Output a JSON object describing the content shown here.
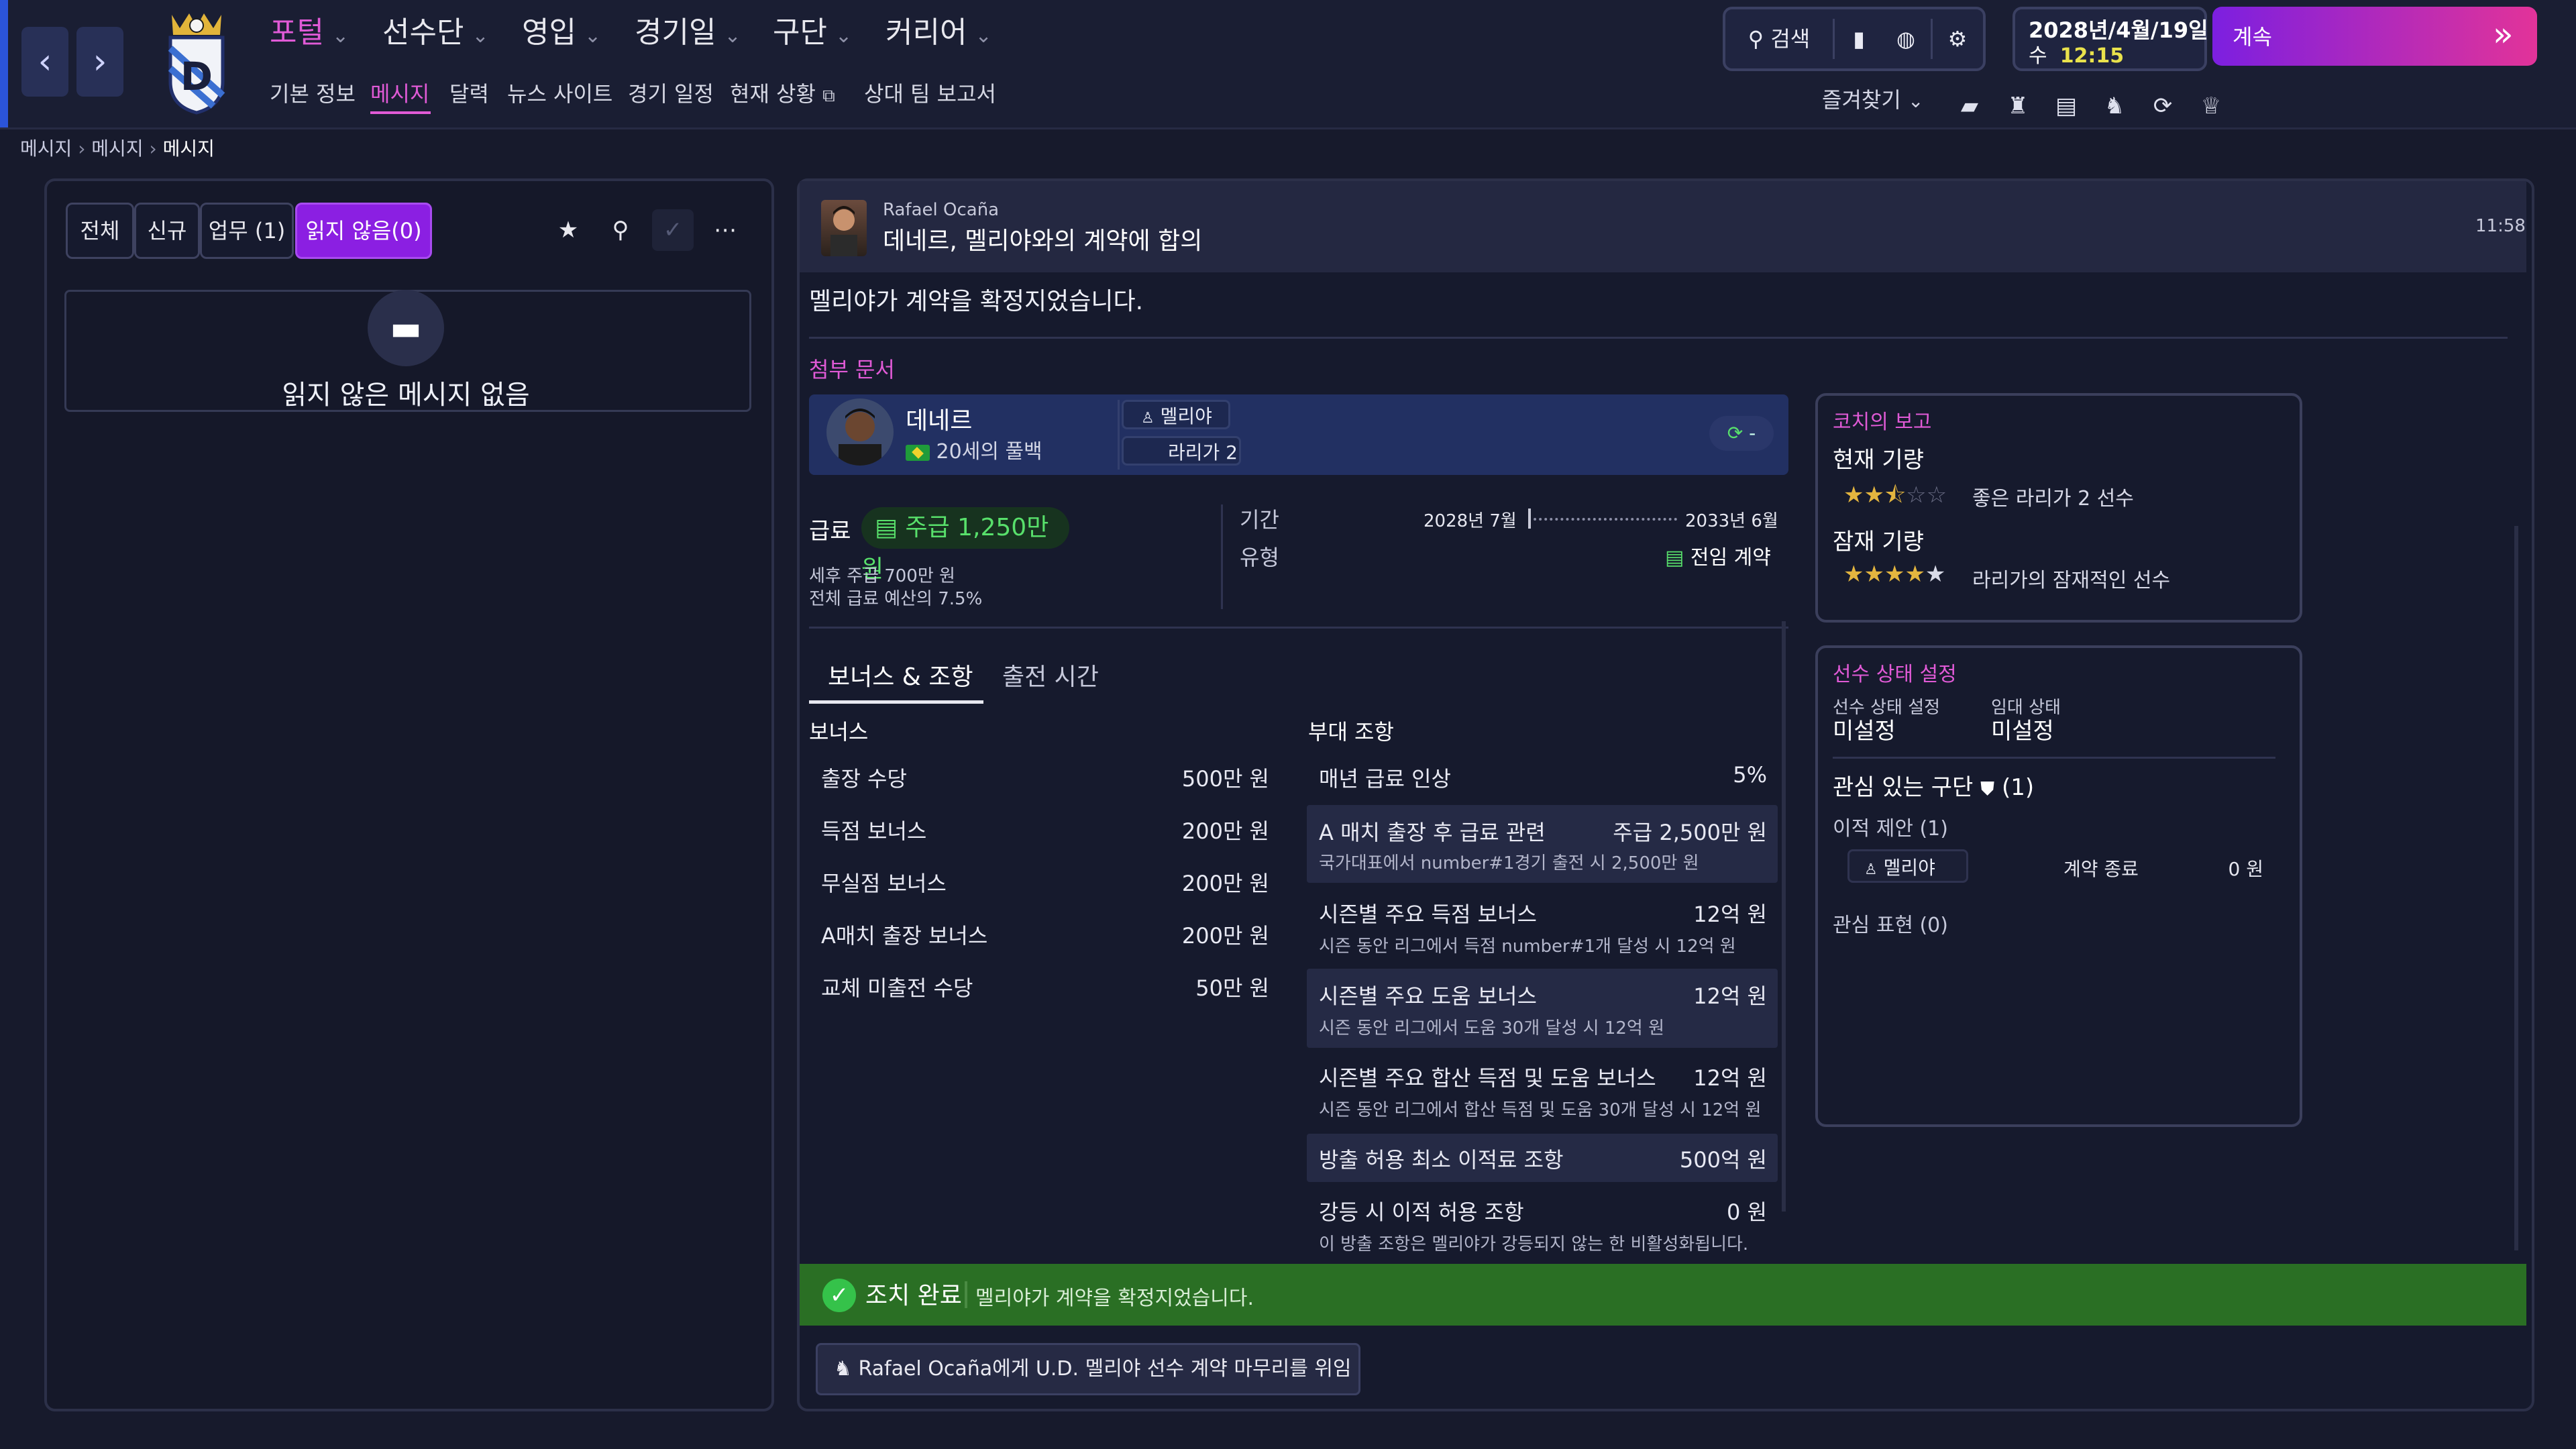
{
  "nav": {
    "menu": [
      {
        "label": "포털",
        "active": true
      },
      {
        "label": "선수단"
      },
      {
        "label": "영입"
      },
      {
        "label": "경기일"
      },
      {
        "label": "구단"
      },
      {
        "label": "커리어"
      }
    ],
    "submenu": [
      "기본 정보",
      "메시지",
      "달력",
      "뉴스 사이트",
      "경기 일정",
      "현재 상황",
      "상대 팀 보고서"
    ],
    "search_label": "검색",
    "date_line": "2028년/4월/19일",
    "day_label": "수",
    "time": "12:15",
    "continue_label": "계속",
    "favorites_label": "즐겨찾기"
  },
  "breadcrumb": [
    "메시지",
    "메시지",
    "메시지"
  ],
  "inbox": {
    "filters": [
      {
        "label": "전체"
      },
      {
        "label": "신규"
      },
      {
        "label": "업무 (1)"
      },
      {
        "label": "읽지 않음(0)",
        "active": true
      }
    ],
    "empty_text": "읽지 않은 메시지 없음"
  },
  "message": {
    "sender": "Rafael Ocaña",
    "subject": "데네르, 멜리야와의 계약에 합의",
    "time": "11:58",
    "body": "멜리야가 계약을 확정지었습니다.",
    "attachment_label": "첨부 문서",
    "player": {
      "name": "데네르",
      "desc": "20세의 풀백",
      "club": "멜리야",
      "league": "라리가 2",
      "toggle": "-"
    },
    "wage_label": "급료",
    "wage_value": "주급 1,250만 원",
    "after_tax": "세후 주급 700만 원",
    "budget_share": "전체 급료 예산의 7.5%",
    "period_label": "기간",
    "period_start": "2028년 7월",
    "period_end": "2033년 6월",
    "type_label": "유형",
    "type_value": "전임 계약",
    "tabs": [
      "보너스 & 조항",
      "출전 시간"
    ],
    "bonus_header": "보너스",
    "bonuses": [
      {
        "name": "출장 수당",
        "value": "500만 원"
      },
      {
        "name": "득점 보너스",
        "value": "200만 원"
      },
      {
        "name": "무실점 보너스",
        "value": "200만 원"
      },
      {
        "name": "A매치 출장 보너스",
        "value": "200만 원"
      },
      {
        "name": "교체 미출전 수당",
        "value": "50만 원"
      }
    ],
    "clause_header": "부대 조항",
    "clauses": [
      {
        "name": "매년 급료 인상",
        "value": "5%",
        "sub": ""
      },
      {
        "name": "A 매치 출장 후 급료 관련",
        "value": "주급 2,500만 원",
        "sub": "국가대표에서 number#1경기 출전 시 2,500만 원"
      },
      {
        "name": "시즌별 주요 득점 보너스",
        "value": "12억 원",
        "sub": "시즌 동안 리그에서 득점 number#1개 달성 시 12억 원"
      },
      {
        "name": "시즌별 주요 도움 보너스",
        "value": "12억 원",
        "sub": "시즌 동안 리그에서 도움 30개 달성 시 12억 원"
      },
      {
        "name": "시즌별 주요 합산 득점 및 도움 보너스",
        "value": "12억 원",
        "sub": "시즌 동안 리그에서 합산 득점 및 도움 30개 달성 시 12억 원"
      },
      {
        "name": "방출 허용 최소 이적료 조항",
        "value": "500억 원",
        "sub": ""
      },
      {
        "name": "강등 시 이적 허용 조항",
        "value": "0 원",
        "sub": "이 방출 조항은 멜리야가 강등되지 않는 한 비활성화됩니다."
      }
    ],
    "coach": {
      "title": "코치의 보고",
      "current_label": "현재 기량",
      "current_stars": 2.5,
      "current_text": "좋은 라리가 2 선수",
      "potential_label": "잠재 기량",
      "potential_stars": 5,
      "potential_text": "라리가의 잠재적인 선수"
    },
    "status": {
      "title": "선수 상태 설정",
      "player_status_label": "선수 상태 설정",
      "player_status_value": "미설정",
      "loan_status_label": "임대 상태",
      "loan_status_value": "미설정",
      "interested_label": "관심 있는 구단",
      "interested_count": "(1)",
      "transfer_offers": "이적 제안 (1)",
      "offer_club": "멜리야",
      "offer_status": "계약 종료",
      "offer_fee": "0 원",
      "interest_shown": "관심 표현 (0)"
    },
    "done_label": "조치 완료",
    "done_text": "멜리야가 계약을 확정지었습니다.",
    "delegate_label": "Rafael Ocaña에게 U.D. 멜리야 선수 계약 마무리를 위임"
  },
  "colors": {
    "accent": "#e05ad6",
    "active_filter": "#8b1fe2",
    "done_bar": "#2a6f24",
    "wage_green": "#58e06b"
  }
}
